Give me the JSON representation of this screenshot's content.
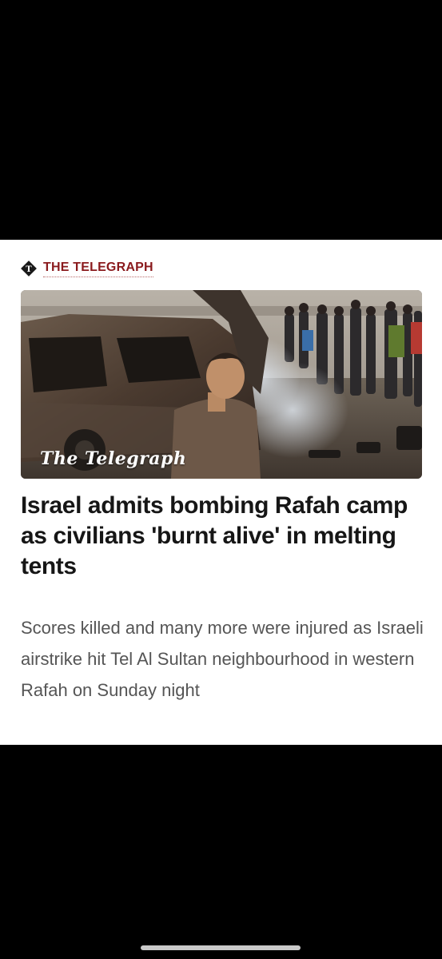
{
  "article": {
    "source": "THE TELEGRAPH",
    "source_logo_icon": "telegraph-diamond-logo-icon",
    "image_watermark": "The Telegraph",
    "headline": "Israel admits bombing Rafah camp as civilians 'burnt alive' in melting tents",
    "summary": "Scores killed and many more were injured as Israeli airstrike hit Tel Al Sultan neighbourhood in western Rafah on Sunday night"
  },
  "colors": {
    "source_red": "#8a1a1d",
    "headline": "#161616",
    "summary": "#555555",
    "background": "#000000",
    "card": "#ffffff"
  }
}
